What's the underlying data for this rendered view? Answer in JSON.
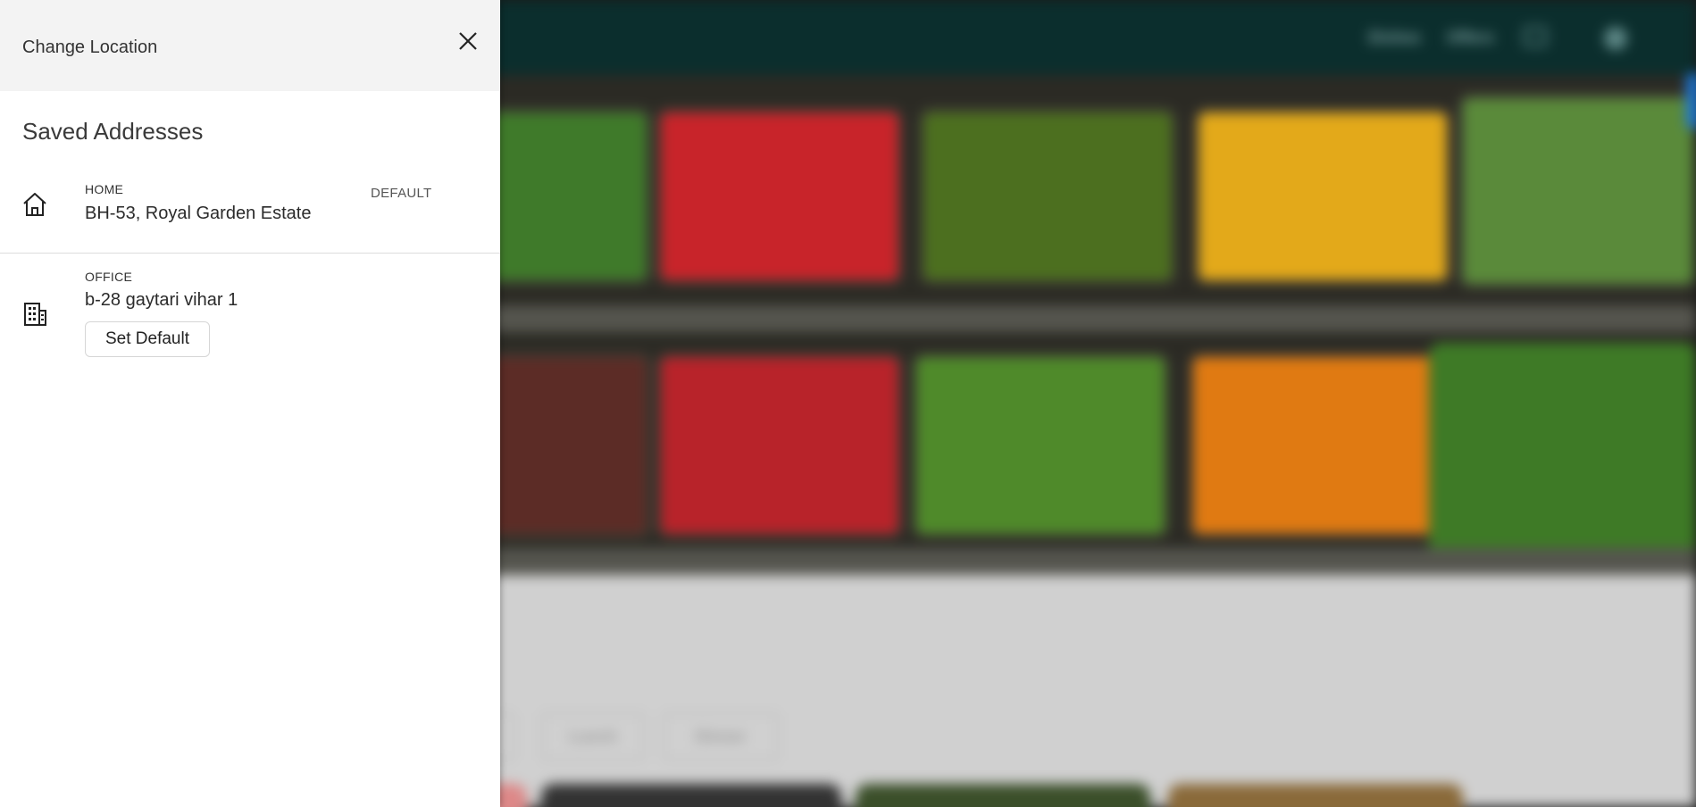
{
  "background_page": {
    "nav_items": [
      "Dishes",
      "Offers"
    ],
    "chips": [
      "Lunch",
      "Dinner"
    ],
    "icons": [
      "cart-icon",
      "user-avatar-icon"
    ]
  },
  "drawer": {
    "title": "Change Location",
    "close_icon": "close-icon",
    "section_title": "Saved Addresses",
    "addresses": [
      {
        "type": "HOME",
        "line": "BH-53, Royal Garden Estate",
        "icon": "home-icon",
        "is_default": true,
        "default_label": "DEFAULT"
      },
      {
        "type": "OFFICE",
        "line": "b-28 gaytari vihar 1",
        "icon": "office-building-icon",
        "is_default": false,
        "action_label": "Set Default"
      }
    ]
  },
  "colors": {
    "header_bg": "#f3f3f3",
    "topbar_bg": "#0b2e2d",
    "accent_blue": "#1f76d2"
  }
}
